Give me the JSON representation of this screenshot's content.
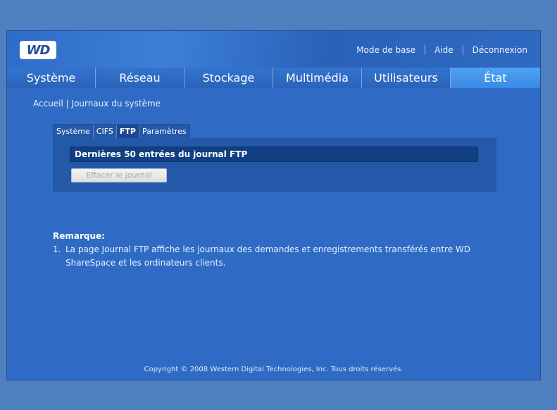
{
  "logo": {
    "text": "WD"
  },
  "toplinks": {
    "basic_mode": "Mode de base",
    "help": "Aide",
    "logout": "Déconnexion"
  },
  "nav": {
    "tabs": [
      {
        "label": "Système"
      },
      {
        "label": "Réseau"
      },
      {
        "label": "Stockage"
      },
      {
        "label": "Multimédia"
      },
      {
        "label": "Utilisateurs"
      },
      {
        "label": "État",
        "active": true
      }
    ]
  },
  "breadcrumb": {
    "home": "Accueil",
    "separator": " | ",
    "current": "Journaux du système"
  },
  "subtabs": [
    {
      "label": "Système"
    },
    {
      "label": "CIFS"
    },
    {
      "label": "FTP",
      "active": true
    },
    {
      "label": "Paramètres"
    }
  ],
  "panel": {
    "title": "Dernières 50 entrées du journal FTP",
    "clear_button": "Effacer le journal"
  },
  "note": {
    "title": "Remarque:",
    "items": [
      {
        "number": "1.",
        "text": "La page Journal FTP affiche les journaux des demandes et enregistrements transférés entre WD ShareSpace et les ordinateurs clients."
      }
    ]
  },
  "footer": {
    "copyright": "Copyright © 2008 Western Digital Technologies, Inc. Tous droits réservés."
  },
  "colors": {
    "background": "#4f7fbe",
    "page": "#2f6bc4",
    "active_tab": "#3a8ae6",
    "panel_bar": "#123f82"
  }
}
